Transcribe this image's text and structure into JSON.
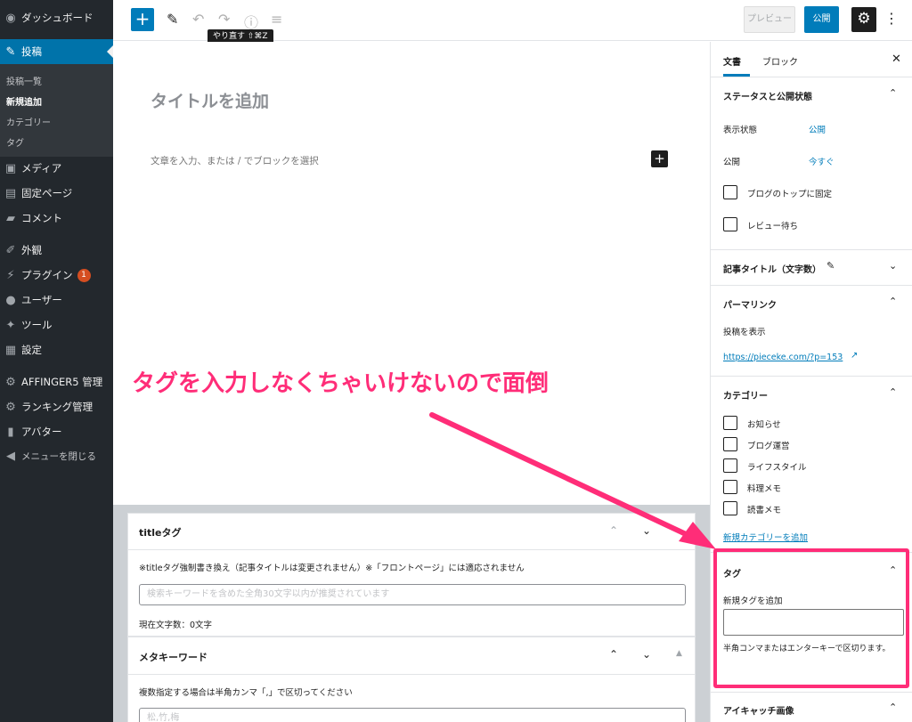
{
  "sidebar": {
    "dashboard": "ダッシュボード",
    "posts": "投稿",
    "posts_sub": [
      "投稿一覧",
      "新規追加",
      "カテゴリー",
      "タグ"
    ],
    "media": "メディア",
    "pages": "固定ページ",
    "comments": "コメント",
    "appearance": "外観",
    "plugins": "プラグイン",
    "plugins_badge": "1",
    "users": "ユーザー",
    "tools": "ツール",
    "settings": "設定",
    "affinger": "AFFINGER5 管理",
    "ranking": "ランキング管理",
    "avatar": "アバター",
    "collapse": "メニューを閉じる"
  },
  "toolbar": {
    "redo_tooltip": "やり直す ⇧⌘Z",
    "preview": "プレビュー",
    "publish": "公開"
  },
  "editor": {
    "title_placeholder": "タイトルを追加",
    "block_placeholder": "文章を入力、または / でブロックを選択"
  },
  "metaboxes": {
    "title_tag": {
      "heading": "titleタグ",
      "note": "※titleタグ強制書き換え（記事タイトルは変更されません）※「フロントページ」には適応されません",
      "placeholder": "検索キーワードを含めた全角30文字以内が推奨されています",
      "count": "現在文字数：0文字"
    },
    "meta_keywords": {
      "heading": "メタキーワード",
      "note": "複数指定する場合は半角カンマ「,」で区切ってください",
      "placeholder": "松,竹,梅"
    }
  },
  "panel": {
    "tab_document": "文書",
    "tab_block": "ブロック",
    "status_heading": "ステータスと公開状態",
    "visibility_label": "表示状態",
    "visibility_value": "公開",
    "publish_label": "公開",
    "publish_value": "今すぐ",
    "sticky_label": "ブログのトップに固定",
    "pending_label": "レビュー待ち",
    "title_count_heading": "記事タイトル（文字数）",
    "permalink_heading": "パーマリンク",
    "view_post": "投稿を表示",
    "permalink_url": "https://pieceke.com/?p=153",
    "categories_heading": "カテゴリー",
    "categories": [
      "お知らせ",
      "ブログ運営",
      "ライフスタイル",
      "料理メモ",
      "読書メモ"
    ],
    "add_category": "新規カテゴリーを追加",
    "tags_heading": "タグ",
    "add_tag_label": "新規タグを追加",
    "tag_help": "半角コンマまたはエンターキーで区切ります。",
    "featured_heading": "アイキャッチ画像"
  },
  "annotation": {
    "text": "タグを入力しなくちゃいけないので面倒",
    "color": "#ff2d78"
  }
}
